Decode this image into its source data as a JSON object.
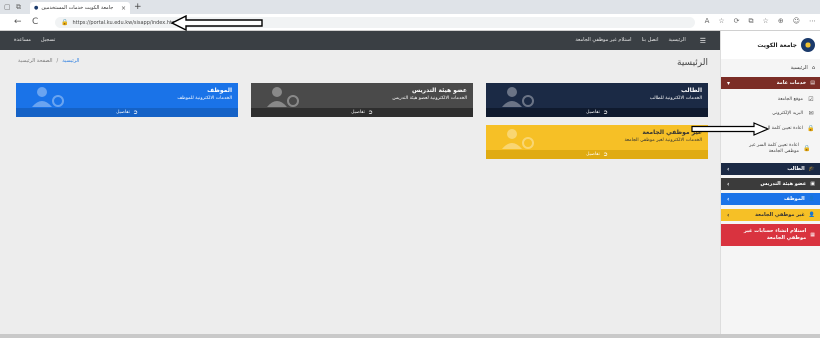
{
  "browser": {
    "tab_title": "جامعة الكويت خدمات المستخدمين",
    "tab_close": "×",
    "new_tab": "+",
    "url": "https://portal.ku.edu.kw/sisapp/index.html",
    "nav_back": "←",
    "nav_reload": "C",
    "lock": "🔒",
    "toolbar_icons": [
      "A",
      "☆",
      "⟳",
      "⧉",
      "☆",
      "⊕",
      "☺",
      "⋯"
    ]
  },
  "header": {
    "left_items": [
      "مساعدة",
      "تسجيل"
    ],
    "right_items": [
      "الرئيسية",
      "اتصل بنا",
      "استلام غير موظفي الجامعة"
    ],
    "menu_icon": "☰"
  },
  "sidebar": {
    "brand": "جامعة الكويت",
    "home": "الرئيسية",
    "home_icon": "⌂",
    "general_section": {
      "label": "خدمات عامة",
      "icon": "▤",
      "chevron": "▾",
      "color": "#7b2d26"
    },
    "general_items": [
      {
        "label": "موقع الجامعة",
        "icon": "☑"
      },
      {
        "label": "البريد الإلكتروني",
        "icon": "✉"
      },
      {
        "label": "اعادة تعيين كلمة السر",
        "icon": "🔒"
      },
      {
        "label": "اعادة تعيين كلمة السر غير موظفي الجامعة",
        "icon": "🔒"
      }
    ],
    "sections": [
      {
        "label": "الطالب",
        "icon": "🎓",
        "chevron": "‹",
        "bg": "#1b2a45",
        "fg": "#ffffff"
      },
      {
        "label": "عضو هيئة التدريس",
        "icon": "▣",
        "chevron": "‹",
        "bg": "#3b3b3b",
        "fg": "#ffffff"
      },
      {
        "label": "الموظف",
        "icon": "👤",
        "chevron": "‹",
        "bg": "#1a73e8",
        "fg": "#ffffff"
      },
      {
        "label": "غير موظفي الجامعة",
        "icon": "👤",
        "chevron": "‹",
        "bg": "#f6c026",
        "fg": "#333333"
      },
      {
        "label": "استلام انشاء حسابات غير موظفي الجامعة",
        "icon": "▦",
        "chevron": "",
        "bg": "#d9333f",
        "fg": "#ffffff"
      }
    ]
  },
  "content": {
    "title": "الرئيسية",
    "breadcrumb_current": "الصفحة الرئيسية",
    "breadcrumb_sep": "/",
    "breadcrumb_link": "الرئيسية",
    "cards": [
      {
        "title": "الطالب",
        "desc": "الخدمات الالكترونية للطالب",
        "details": "تفاصيل",
        "bg": "#1b2a45",
        "footer_bg": "#0f1a2e",
        "fg": "#ffffff"
      },
      {
        "title": "عضو هيئة التدريس",
        "desc": "الخدمات الالكترونية لعضو هيئة التدريس",
        "details": "تفاصيل",
        "bg": "#4a4a4a",
        "footer_bg": "#2e2e2e",
        "fg": "#ffffff"
      },
      {
        "title": "الموظف",
        "desc": "الخدمات الالكترونية للموظف",
        "details": "تفاصيل",
        "bg": "#1a73e8",
        "footer_bg": "#1562c6",
        "fg": "#ffffff"
      },
      {
        "title": "غير موظفي الجامعة",
        "desc": "الخدمات الالكترونية لغير موظفي الجامعة",
        "details": "تفاصيل",
        "bg": "#f6c026",
        "footer_bg": "#e0ab12",
        "fg": "#333333"
      }
    ]
  }
}
